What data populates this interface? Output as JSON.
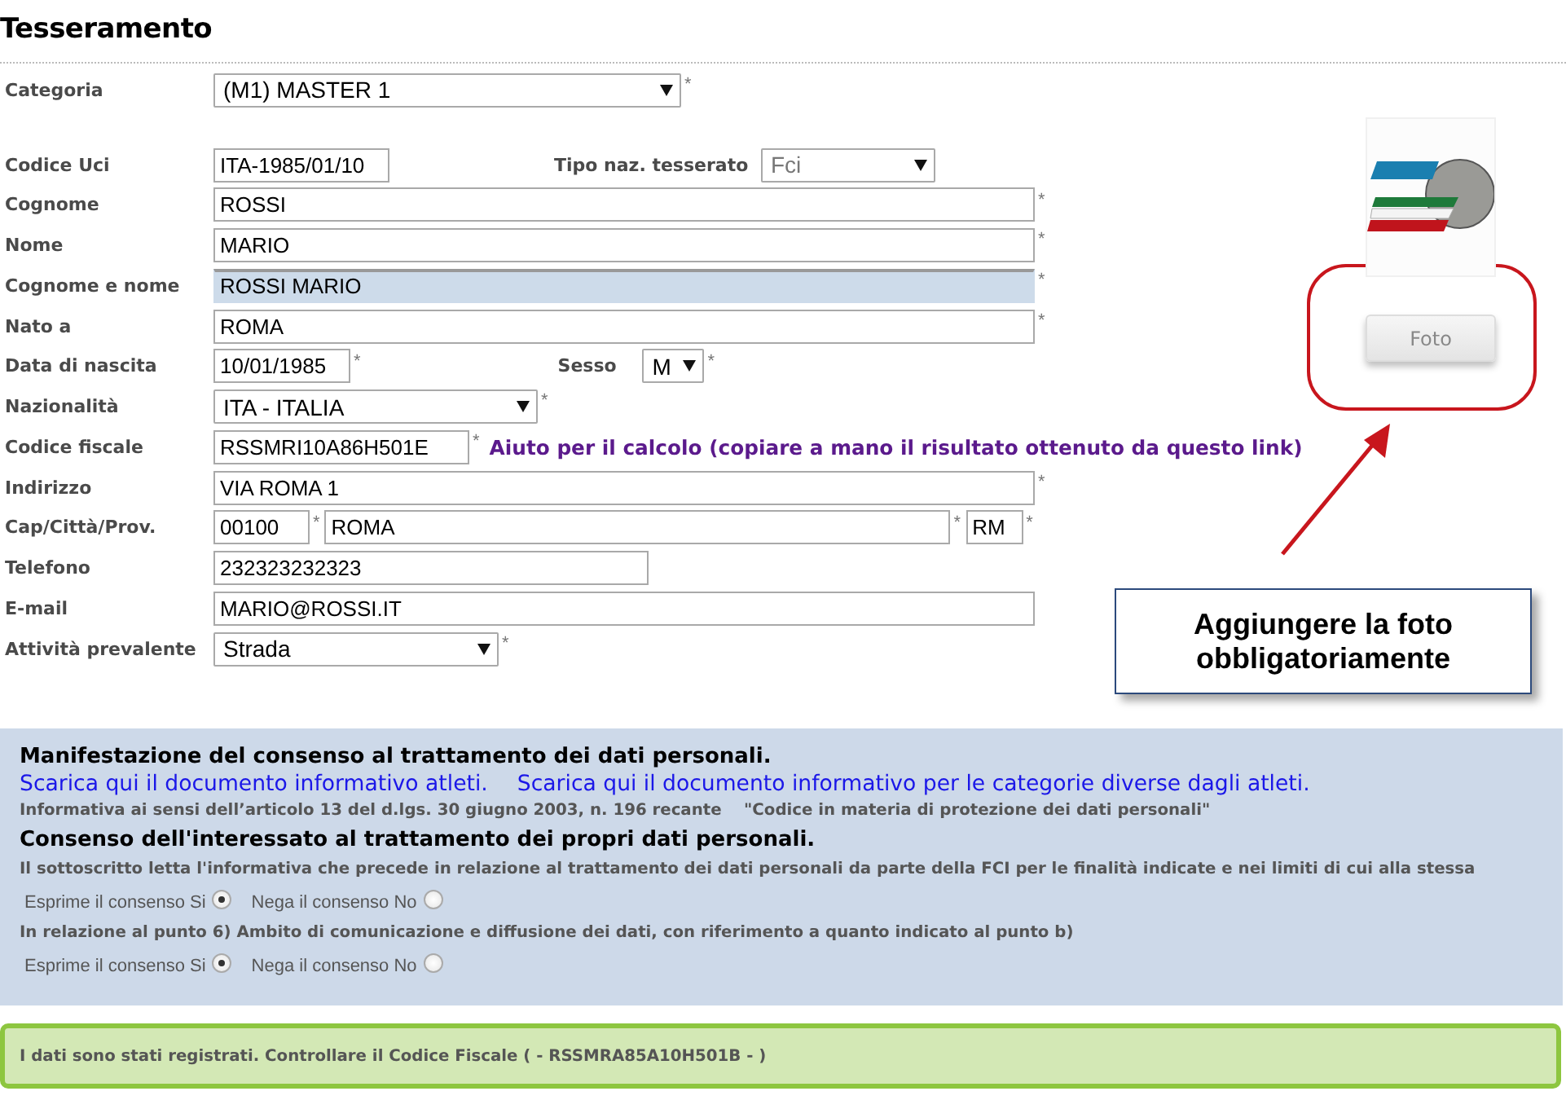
{
  "page": {
    "title": "Tesseramento"
  },
  "form": {
    "sections": [
      {
        "rows": [
          {
            "label": "Categoria",
            "items": [
              {
                "kind": "select",
                "value": "(M1) MASTER 1",
                "note": "*"
              }
            ]
          }
        ]
      },
      {
        "rows": [
          {
            "label": "Codice Uci",
            "items": [
              {
                "kind": "input",
                "value": "ITA-1985/01/10"
              },
              {
                "kind": "label",
                "text": "Tipo naz. tesserato"
              },
              {
                "kind": "select",
                "value": "Fci",
                "disabled": true
              }
            ]
          },
          {
            "label": "Cognome",
            "items": [
              {
                "kind": "input",
                "value": "ROSSI",
                "note": "*"
              }
            ]
          },
          {
            "label": "Nome",
            "items": [
              {
                "kind": "input",
                "value": "MARIO",
                "note": "*"
              }
            ]
          },
          {
            "label": "Cognome e nome",
            "items": [
              {
                "kind": "input",
                "value": "ROSSI MARIO",
                "note": "*",
                "highlighted": true
              }
            ]
          },
          {
            "label": "Nato a",
            "items": [
              {
                "kind": "input",
                "value": "ROMA",
                "note": "*"
              }
            ]
          },
          {
            "label": "Data di nascita",
            "items": [
              {
                "kind": "input",
                "value": "10/01/1985",
                "note": "*"
              },
              {
                "kind": "label",
                "text": "Sesso"
              },
              {
                "kind": "select",
                "value": "M",
                "note": "*"
              }
            ]
          },
          {
            "label": "Nazionalità",
            "items": [
              {
                "kind": "select",
                "value": "ITA - ITALIA",
                "note": "*"
              }
            ]
          },
          {
            "label": "Codice fiscale",
            "items": [
              {
                "kind": "input",
                "value": "RSSMRI10A86H501E",
                "note": "*"
              },
              {
                "kind": "link",
                "text": "Aiuto per il calcolo (copiare a mano il risultato ottenuto da questo link)"
              }
            ]
          },
          {
            "label": "Indirizzo",
            "items": [
              {
                "kind": "input",
                "value": "VIA ROMA 1",
                "note": "*"
              }
            ]
          },
          {
            "label": "Cap/Città/Prov.",
            "items": [
              {
                "kind": "input",
                "value": "00100",
                "note": "*"
              },
              {
                "kind": "input",
                "value": "ROMA",
                "note": "*"
              },
              {
                "kind": "input",
                "value": "RM",
                "note": "*"
              }
            ]
          },
          {
            "label": "Telefono",
            "items": [
              {
                "kind": "input",
                "value": "232323232323"
              }
            ]
          },
          {
            "label": "E-mail",
            "items": [
              {
                "kind": "input",
                "value": "MARIO@ROSSI.IT"
              }
            ]
          },
          {
            "label": "Attività prevalente",
            "items": [
              {
                "kind": "select",
                "value": "Strada",
                "note": "*"
              }
            ]
          }
        ]
      }
    ]
  },
  "photo": {
    "button": "Foto"
  },
  "callout": {
    "text": "Aggiungere la foto obbligatoriamente"
  },
  "consent": {
    "blocks": [
      {
        "kind": "heading",
        "text": "Manifestazione del consenso al trattamento dei dati personali."
      },
      {
        "kind": "links",
        "links": [
          "Scarica qui il documento informativo atleti.",
          "Scarica qui il documento informativo per le categorie diverse dagli atleti."
        ]
      },
      {
        "kind": "note",
        "text": "Informativa ai sensi dell’articolo 13 del d.lgs. 30 giugno 2003, n. 196 recante    \"Codice in materia di protezione dei dati personali\""
      },
      {
        "kind": "heading",
        "text": "Consenso dell'interessato al trattamento dei propri dati personali."
      },
      {
        "kind": "note",
        "text": "Il sottoscritto letta l'informativa che precede in relazione al trattamento dei dati personali da parte della FCI per le finalità indicate e nei limiti di cui alla stessa"
      },
      {
        "kind": "radios",
        "options": [
          {
            "label": "Esprime il consenso Si",
            "selected": true
          },
          {
            "label": "Nega il consenso No",
            "selected": false
          }
        ]
      },
      {
        "kind": "note",
        "text": "In relazione al punto 6) Ambito di comunicazione e diffusione dei dati, con riferimento a quanto indicato al punto b)"
      },
      {
        "kind": "radios",
        "options": [
          {
            "label": "Esprime il consenso Si",
            "selected": true
          },
          {
            "label": "Nega il consenso No",
            "selected": false
          }
        ]
      }
    ]
  },
  "notice": {
    "text": "I dati sono stati registrati. Controllare il Codice Fiscale ( - RSSMRA85A10H501B - )"
  }
}
